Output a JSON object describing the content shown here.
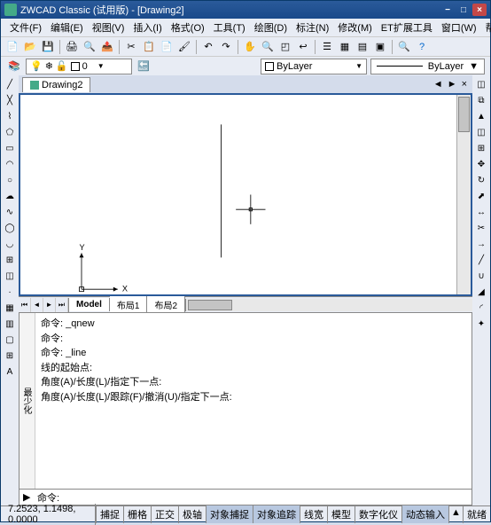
{
  "title": "ZWCAD Classic (试用版) - [Drawing2]",
  "menu": [
    "文件(F)",
    "编辑(E)",
    "视图(V)",
    "插入(I)",
    "格式(O)",
    "工具(T)",
    "绘图(D)",
    "标注(N)",
    "修改(M)",
    "ET扩展工具",
    "窗口(W)",
    "帮助(H)"
  ],
  "layer_current": "0",
  "linetype": "ByLayer",
  "linestyle": "ByLayer",
  "dwg_tab": "Drawing2",
  "model_tabs": [
    "Model",
    "布局1",
    "布局2"
  ],
  "cmd_history": "命令: _qnew\n命令:\n命令: _line\n线的起始点:\n角度(A)/长度(L)/指定下一点:\n角度(A)/长度(L)/跟踪(F)/撤消(U)/指定下一点:",
  "cmd_label": "最少化",
  "cmd_prompt": "命令:",
  "coords": "7.2523, 1.1498, 0.0000",
  "status_btns": [
    "捕捉",
    "栅格",
    "正交",
    "极轴",
    "对象捕捉",
    "对象追踪",
    "线宽",
    "模型",
    "数字化仪",
    "动态输入",
    "就绪"
  ],
  "status_active": [
    4,
    5,
    9
  ],
  "axis_x": "X",
  "axis_y": "Y",
  "winbtns": {
    "min": "−",
    "max": "□",
    "close": "×",
    "min2": "−",
    "max2": "◫",
    "close2": "×"
  }
}
